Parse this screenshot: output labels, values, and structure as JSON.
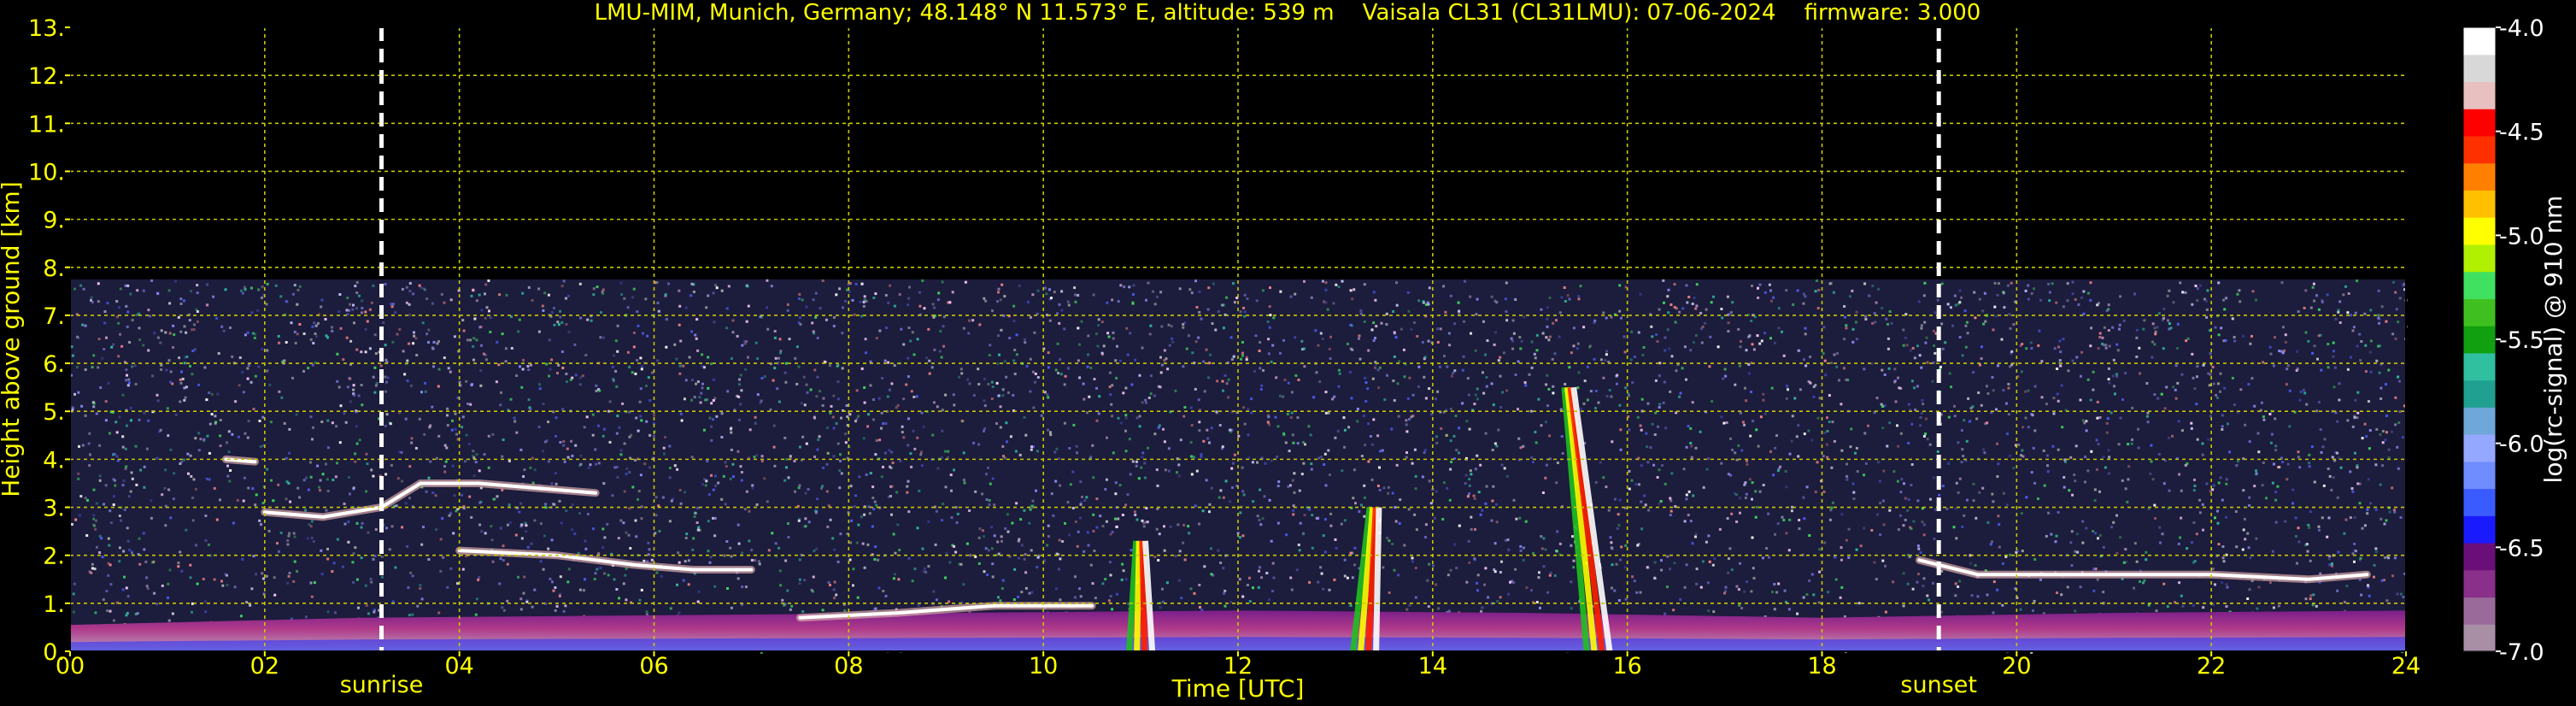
{
  "chart_data": {
    "type": "heatmap",
    "title": "LMU-MIM, Munich, Germany; 48.148° N 11.573° E, altitude: 539 m    Vaisala CL31 (CL31LMU): 07-06-2024    firmware: 3.000",
    "xlabel": "Time [UTC]",
    "ylabel": "Height above ground [km]",
    "xlim": [
      0,
      24
    ],
    "ylim": [
      0,
      13
    ],
    "x_ticks": [
      "00",
      "02",
      "04",
      "06",
      "08",
      "10",
      "12",
      "14",
      "16",
      "18",
      "20",
      "22",
      "24"
    ],
    "y_ticks": [
      "0.",
      "1.",
      "2.",
      "3.",
      "4.",
      "5.",
      "6.",
      "7.",
      "8.",
      "9.",
      "10.",
      "11.",
      "12.",
      "13."
    ],
    "grid": true,
    "data_top_km": 7.75,
    "events": [
      {
        "name": "sunrise",
        "time_h": 3.2
      },
      {
        "name": "sunset",
        "time_h": 19.2
      }
    ],
    "colorbar": {
      "label": "log(rc-signal) @ 910 nm",
      "range": [
        -7.0,
        -4.0
      ],
      "ticks": [
        "-4.0",
        "-4.5",
        "-5.0",
        "-5.5",
        "-6.0",
        "-6.5",
        "-7.0"
      ],
      "colors": [
        "#a88fa6",
        "#9a6b9a",
        "#8a2f8a",
        "#6a0f7a",
        "#1a1aff",
        "#3a5bff",
        "#6f8dff",
        "#95a8ff",
        "#6fa8d8",
        "#20a090",
        "#30c0a0",
        "#10a010",
        "#40c020",
        "#40e060",
        "#b0f000",
        "#ffff00",
        "#ffc000",
        "#ff8000",
        "#ff3000",
        "#ff0000",
        "#e8c0c0",
        "#d8d8d8",
        "#ffffff"
      ]
    },
    "features": [
      {
        "kind": "boundary-layer",
        "points": [
          [
            0.0,
            0.55
          ],
          [
            3.0,
            0.7
          ],
          [
            6.0,
            0.75
          ],
          [
            9.0,
            0.8
          ],
          [
            12.0,
            0.85
          ],
          [
            15.0,
            0.8
          ],
          [
            18.0,
            0.7
          ],
          [
            21.0,
            0.8
          ],
          [
            24.0,
            0.85
          ]
        ]
      },
      {
        "kind": "aerosol-layer",
        "points": [
          [
            2.0,
            2.9
          ],
          [
            2.6,
            2.8
          ],
          [
            3.2,
            3.0
          ],
          [
            3.6,
            3.5
          ],
          [
            4.2,
            3.5
          ],
          [
            4.8,
            3.4
          ],
          [
            5.4,
            3.3
          ]
        ]
      },
      {
        "kind": "aerosol-layer",
        "points": [
          [
            4.0,
            2.1
          ],
          [
            5.0,
            2.0
          ],
          [
            5.8,
            1.8
          ],
          [
            6.4,
            1.7
          ],
          [
            7.0,
            1.7
          ]
        ]
      },
      {
        "kind": "aerosol-layer",
        "points": [
          [
            7.5,
            0.7
          ],
          [
            8.5,
            0.8
          ],
          [
            9.5,
            0.95
          ],
          [
            10.5,
            0.95
          ]
        ]
      },
      {
        "kind": "aerosol-layer",
        "points": [
          [
            1.6,
            4.0
          ],
          [
            1.9,
            3.95
          ]
        ]
      },
      {
        "kind": "aerosol-layer",
        "points": [
          [
            19.0,
            1.9
          ],
          [
            19.6,
            1.6
          ],
          [
            20.5,
            1.6
          ],
          [
            21.3,
            1.6
          ],
          [
            22.0,
            1.6
          ],
          [
            23.0,
            1.5
          ],
          [
            23.6,
            1.6
          ]
        ]
      },
      {
        "kind": "precipitation",
        "points": [
          [
            11.0,
            0.0
          ],
          [
            11.0,
            2.3
          ]
        ]
      },
      {
        "kind": "precipitation",
        "points": [
          [
            13.3,
            0.0
          ],
          [
            13.4,
            3.0
          ]
        ]
      },
      {
        "kind": "precipitation",
        "points": [
          [
            15.7,
            0.0
          ],
          [
            15.4,
            5.5
          ]
        ]
      }
    ]
  }
}
